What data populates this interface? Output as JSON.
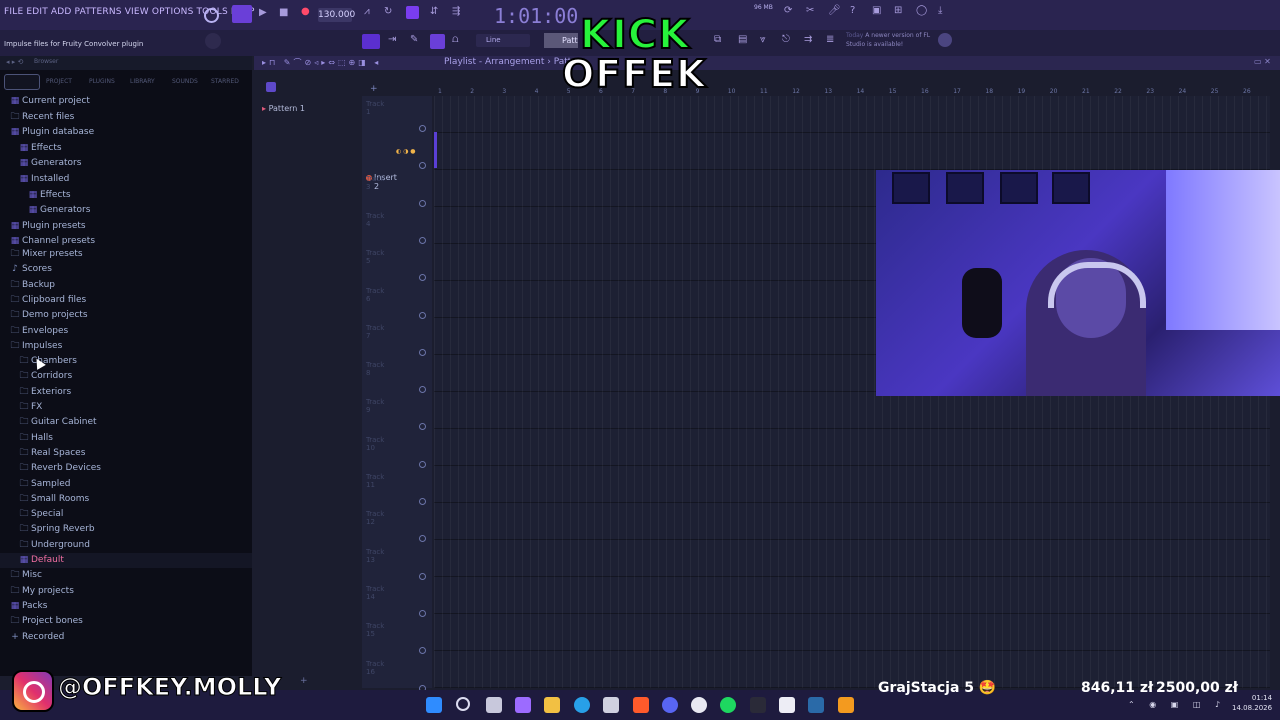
{
  "menu": [
    "FILE",
    "EDIT",
    "ADD",
    "PATTERNS",
    "VIEW",
    "OPTIONS",
    "TOOLS",
    "HELP"
  ],
  "transport": {
    "tempo": "130.000",
    "time": "1:01:00",
    "mem": "96 MB"
  },
  "hint": "Impulse files for Fruity Convolver plugin",
  "toolbar": {
    "snap": "Line",
    "pattern_label": "Patt",
    "newver": "A newer version of FL Studio is available!",
    "newver_day": "Today"
  },
  "browser": {
    "title": "Browser",
    "tabs": [
      "PROJECT",
      "PLUGINS",
      "LIBRARY",
      "SOUNDS",
      "STARRED"
    ],
    "items": [
      {
        "label": "Current project",
        "indent": 0,
        "icon": "sq"
      },
      {
        "label": "Recent files",
        "indent": 0,
        "icon": "folder"
      },
      {
        "label": "Plugin database",
        "indent": 0,
        "icon": "sq"
      },
      {
        "label": "Effects",
        "indent": 1,
        "icon": "sq"
      },
      {
        "label": "Generators",
        "indent": 1,
        "icon": "sq"
      },
      {
        "label": "Installed",
        "indent": 1,
        "icon": "sq"
      },
      {
        "label": "Effects",
        "indent": 2,
        "icon": "sq"
      },
      {
        "label": "Generators",
        "indent": 2,
        "icon": "sq"
      },
      {
        "label": "Plugin presets",
        "indent": 0,
        "icon": "sq"
      },
      {
        "label": "Channel presets",
        "indent": 0,
        "icon": "sq"
      },
      {
        "label": "Mixer presets",
        "indent": 0,
        "icon": "folder"
      },
      {
        "label": "Scores",
        "indent": 0,
        "icon": "note"
      },
      {
        "label": "Backup",
        "indent": 0,
        "icon": "folder"
      },
      {
        "label": "Clipboard files",
        "indent": 0,
        "icon": "folder"
      },
      {
        "label": "Demo projects",
        "indent": 0,
        "icon": "folder"
      },
      {
        "label": "Envelopes",
        "indent": 0,
        "icon": "folder"
      },
      {
        "label": "Impulses",
        "indent": 0,
        "icon": "folder"
      },
      {
        "label": "Chambers",
        "indent": 1,
        "icon": "folder"
      },
      {
        "label": "Corridors",
        "indent": 1,
        "icon": "folder"
      },
      {
        "label": "Exteriors",
        "indent": 1,
        "icon": "folder"
      },
      {
        "label": "FX",
        "indent": 1,
        "icon": "folder"
      },
      {
        "label": "Guitar Cabinet",
        "indent": 1,
        "icon": "folder"
      },
      {
        "label": "Halls",
        "indent": 1,
        "icon": "folder"
      },
      {
        "label": "Real Spaces",
        "indent": 1,
        "icon": "folder"
      },
      {
        "label": "Reverb Devices",
        "indent": 1,
        "icon": "folder"
      },
      {
        "label": "Sampled",
        "indent": 1,
        "icon": "folder"
      },
      {
        "label": "Small Rooms",
        "indent": 1,
        "icon": "folder"
      },
      {
        "label": "Special",
        "indent": 1,
        "icon": "folder"
      },
      {
        "label": "Spring Reverb",
        "indent": 1,
        "icon": "folder"
      },
      {
        "label": "Underground",
        "indent": 1,
        "icon": "folder"
      },
      {
        "label": "Default",
        "indent": 1,
        "icon": "sq",
        "selected": true
      },
      {
        "label": "Misc",
        "indent": 0,
        "icon": "folder"
      },
      {
        "label": "My projects",
        "indent": 0,
        "icon": "folder"
      },
      {
        "label": "Packs",
        "indent": 0,
        "icon": "sq"
      },
      {
        "label": "Project bones",
        "indent": 0,
        "icon": "folder"
      },
      {
        "label": "Recorded",
        "indent": 0,
        "icon": "plus"
      }
    ]
  },
  "pattern_list": [
    "Pattern 1"
  ],
  "playlist": {
    "title": "Playlist - Arrangement",
    "crumb": "Patt",
    "insert_label": "Insert 2",
    "tracks": [
      "Track 1",
      "Insert 2",
      "Track 3",
      "Track 4",
      "Track 5",
      "Track 6",
      "Track 7",
      "Track 8",
      "Track 9",
      "Track 10",
      "Track 11",
      "Track 12",
      "Track 13",
      "Track 14",
      "Track 15",
      "Track 16"
    ],
    "ruler": [
      "1",
      "2",
      "3",
      "4",
      "5",
      "6",
      "7",
      "8",
      "9",
      "10",
      "11",
      "12",
      "13",
      "14",
      "15",
      "16",
      "17",
      "18",
      "19",
      "20",
      "21",
      "22",
      "23",
      "24",
      "25",
      "26"
    ]
  },
  "overlay": {
    "line1": "KICK",
    "line2": "OFFEK",
    "instagram": "@OFFKEY.MOLLY"
  },
  "stream": {
    "donation": "GrajStacja 5 🤩",
    "amount1": "846,11 zł",
    "amount2": "2500,00 zł"
  },
  "clock": {
    "time": "01:14",
    "date": "14.08.2026"
  }
}
